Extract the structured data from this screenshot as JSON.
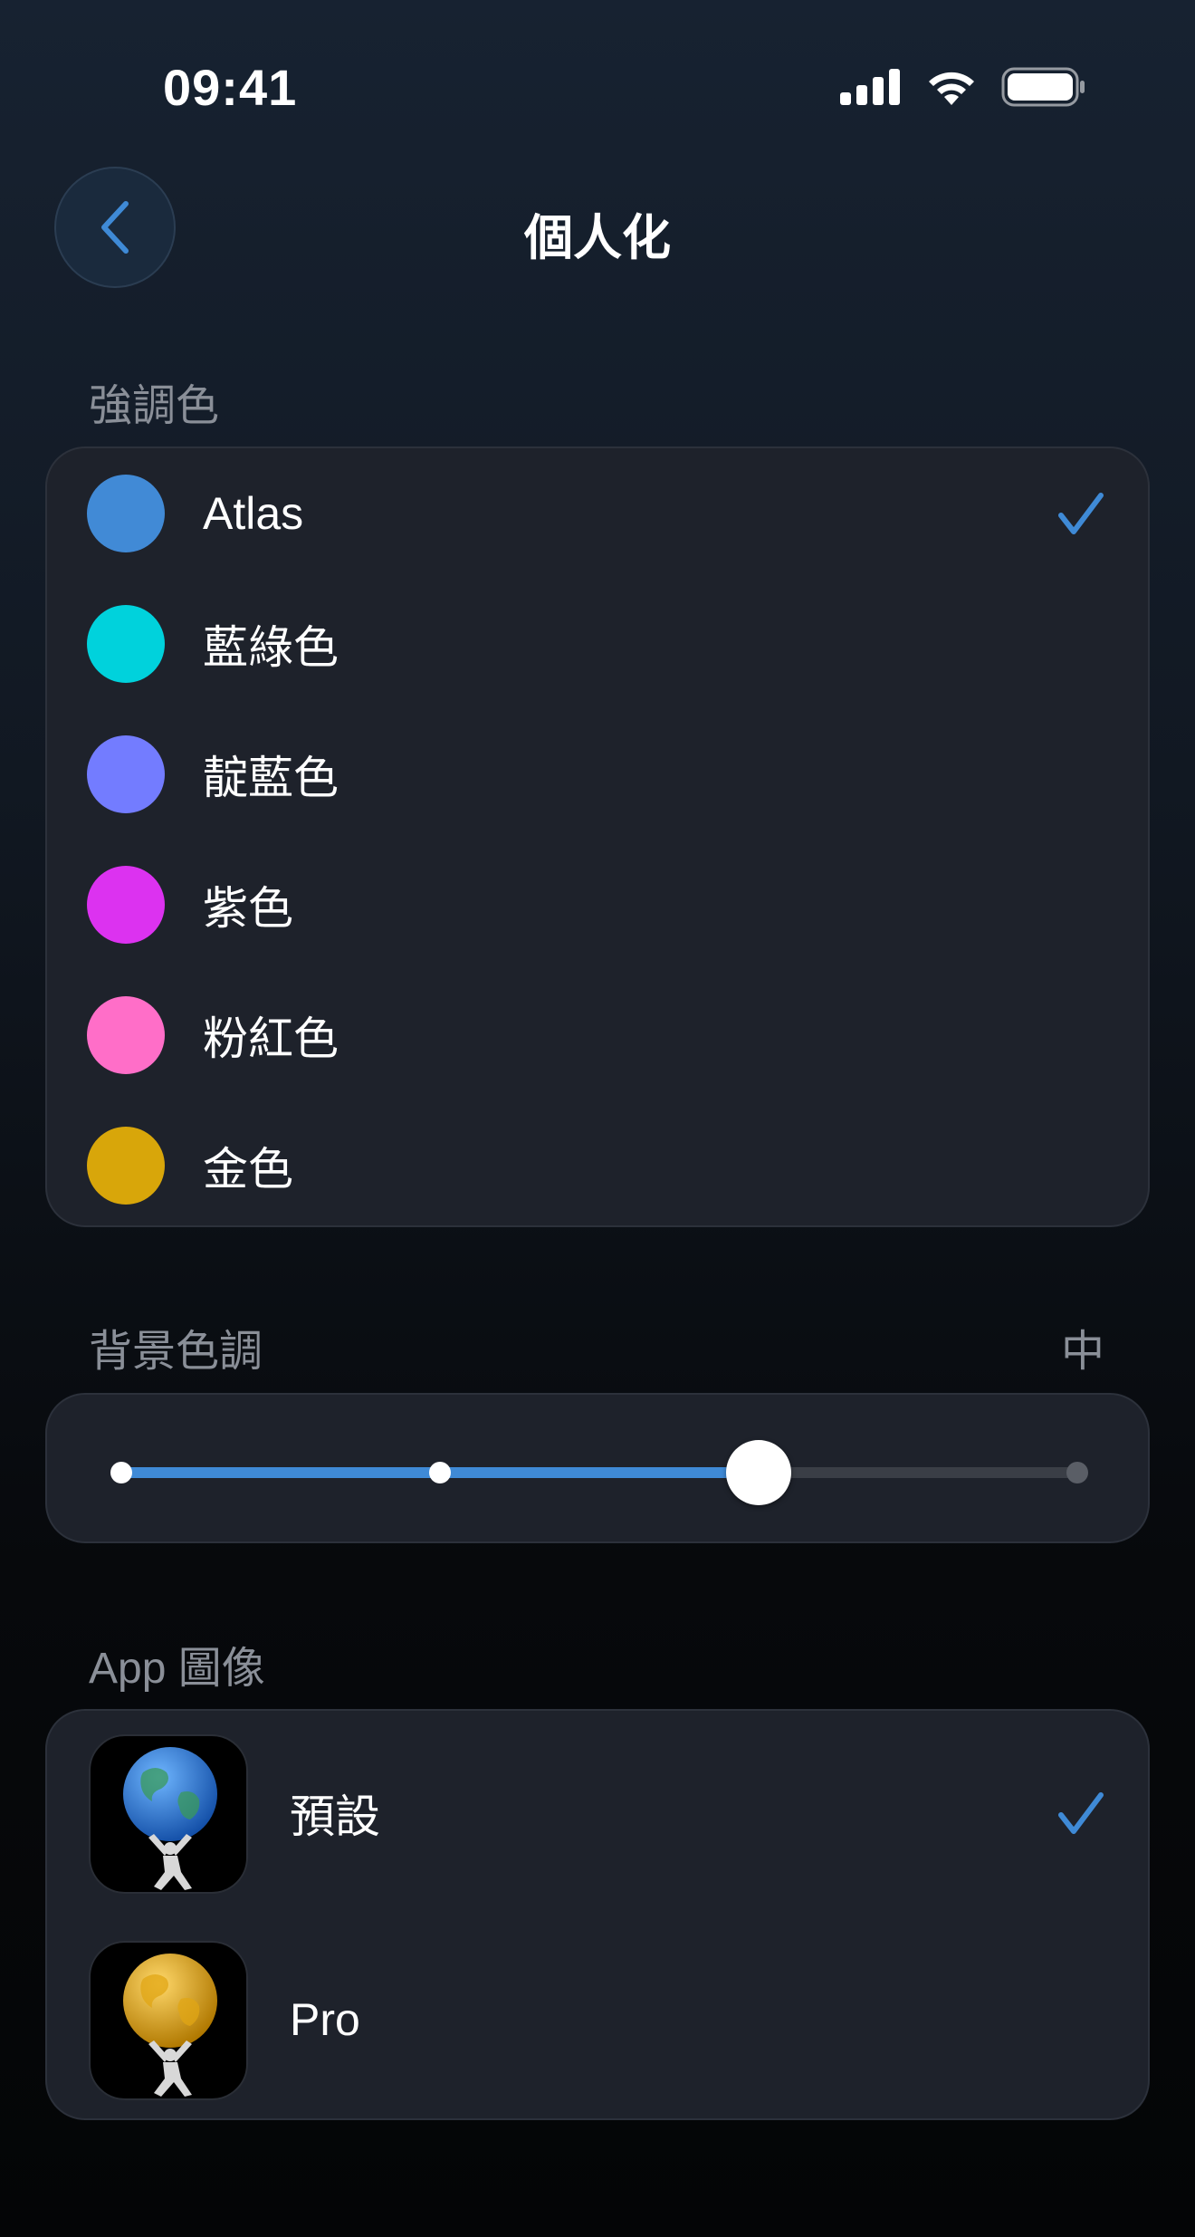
{
  "status_bar": {
    "time": "09:41",
    "icons": [
      "cellular-signal-icon",
      "wifi-icon",
      "battery-icon"
    ]
  },
  "nav": {
    "back_icon": "chevron-left-icon",
    "title": "個人化"
  },
  "accent": {
    "header": "強調色",
    "selected": "Atlas",
    "items": [
      {
        "label": "Atlas",
        "color": "#418ad6",
        "selected": true
      },
      {
        "label": "藍綠色",
        "color": "#00d2dc",
        "selected": false
      },
      {
        "label": "靛藍色",
        "color": "#737cff",
        "selected": false
      },
      {
        "label": "紫色",
        "color": "#dc32f0",
        "selected": false
      },
      {
        "label": "粉紅色",
        "color": "#ff6ec8",
        "selected": false
      },
      {
        "label": "金色",
        "color": "#d8a60a",
        "selected": false
      }
    ],
    "check_color": "#3f8ad6"
  },
  "background_tone": {
    "header": "背景色調",
    "value_label": "中",
    "stops": 4,
    "selected_index": 2,
    "fill_color": "#3f8ad6"
  },
  "app_icon": {
    "header": "App 圖像",
    "items": [
      {
        "label": "預設",
        "icon": "atlas-blue-globe-icon",
        "selected": true
      },
      {
        "label": "Pro",
        "icon": "atlas-gold-globe-icon",
        "selected": false
      }
    ]
  }
}
